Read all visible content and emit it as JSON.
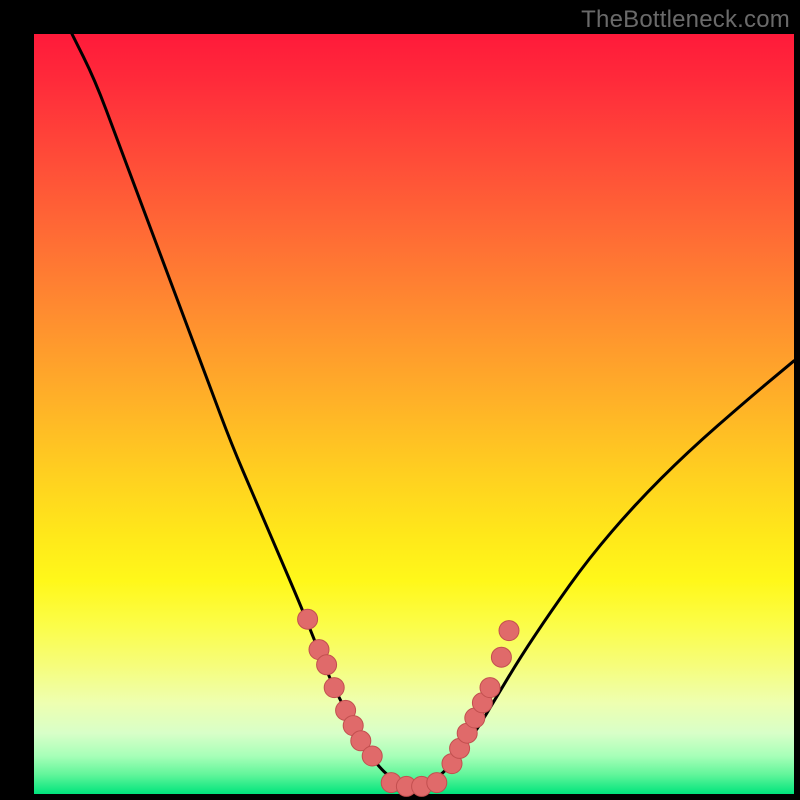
{
  "watermark": "TheBottleneck.com",
  "colors": {
    "curve_stroke": "#000000",
    "dot_fill": "#e06a6a",
    "dot_stroke": "#c24f4f"
  },
  "chart_data": {
    "type": "line",
    "title": "",
    "xlabel": "",
    "ylabel": "",
    "xlim": [
      0,
      100
    ],
    "ylim": [
      0,
      100
    ],
    "series": [
      {
        "name": "bottleneck-curve",
        "x_percent": [
          5,
          8,
          11,
          14,
          17,
          20,
          23,
          26,
          29,
          32,
          35,
          37,
          39,
          41,
          43,
          45,
          47,
          49,
          51,
          53,
          55,
          58,
          61,
          64,
          68,
          73,
          79,
          86,
          94,
          100
        ],
        "y_percent": [
          100,
          94,
          86,
          78,
          70,
          62,
          54,
          46,
          39,
          32,
          25,
          20,
          15,
          11,
          7,
          4,
          2,
          1,
          1,
          2,
          4,
          8,
          13,
          18,
          24,
          31,
          38,
          45,
          52,
          57
        ]
      }
    ],
    "dots": {
      "name": "highlighted-points",
      "x_percent": [
        36.0,
        37.5,
        38.5,
        39.5,
        41.0,
        42.0,
        43.0,
        44.5,
        47.0,
        49.0,
        51.0,
        53.0,
        55.0,
        56.0,
        57.0,
        58.0,
        59.0,
        60.0,
        61.5,
        62.5
      ],
      "y_percent": [
        23.0,
        19.0,
        17.0,
        14.0,
        11.0,
        9.0,
        7.0,
        5.0,
        1.5,
        1.0,
        1.0,
        1.5,
        4.0,
        6.0,
        8.0,
        10.0,
        12.0,
        14.0,
        18.0,
        21.5
      ],
      "radius_px": 10
    }
  }
}
